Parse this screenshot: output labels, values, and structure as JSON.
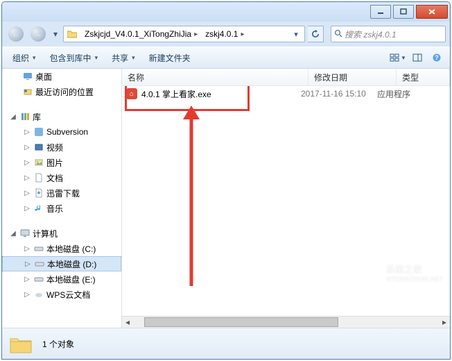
{
  "window": {
    "min_icon": "minimize-icon",
    "max_icon": "maximize-icon",
    "close_icon": "close-icon"
  },
  "nav": {
    "breadcrumbs": [
      "Zskjcjd_V4.0.1_XiTongZhiJia",
      "zskj4.0.1"
    ],
    "breadcrumb_sep": "▸",
    "dropdown_glyph": "▾",
    "search_placeholder": "搜索 zskj4.0.1"
  },
  "toolbar": {
    "organize": "组织",
    "include": "包含到库中",
    "share": "共享",
    "newfolder": "新建文件夹"
  },
  "tree": {
    "desktop": "桌面",
    "recent": "最近访问的位置",
    "lib": "库",
    "lib_items": [
      "Subversion",
      "视频",
      "图片",
      "文档",
      "迅雷下载",
      "音乐"
    ],
    "computer": "计算机",
    "drives": [
      "本地磁盘 (C:)",
      "本地磁盘 (D:)",
      "本地磁盘 (E:)"
    ],
    "cutoff": "WPS云文档"
  },
  "columns": {
    "name": "名称",
    "date": "修改日期",
    "type": "类型"
  },
  "rows": [
    {
      "name": "4.0.1 掌上看家.exe",
      "date": "2017-11-16 15:10",
      "type": "应用程序"
    }
  ],
  "status": {
    "count": "1 个对象"
  },
  "watermark": {
    "line1": "系统之家",
    "line2": "XITONGZHIJIA.NET"
  }
}
